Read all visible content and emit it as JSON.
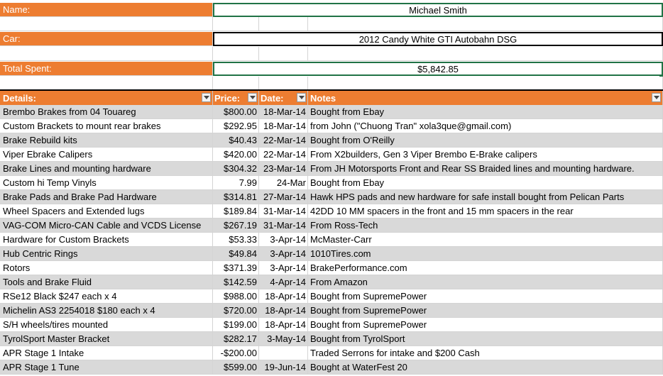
{
  "summary": {
    "name_label": "Name:",
    "name_value": "Michael Smith",
    "car_label": "Car:",
    "car_value": "2012 Candy White GTI Autobahn DSG",
    "total_label": "Total Spent:",
    "total_value": "$5,842.85"
  },
  "table": {
    "headers": [
      "Details:",
      "Price:",
      "Date:",
      "Notes"
    ],
    "rows": [
      [
        "Brembo Brakes from 04 Touareg",
        "$800.00",
        "18-Mar-14",
        "Bought from Ebay"
      ],
      [
        "Custom Brackets to mount rear brakes",
        "$292.95",
        "18-Mar-14",
        " from John (\"Chuong Tran\" xola3que@gmail.com)"
      ],
      [
        "Brake Rebuild kits",
        "$40.43",
        "22-Mar-14",
        "Bought from O'Reilly"
      ],
      [
        "Viper Ebrake Calipers",
        "$420.00",
        "22-Mar-14",
        "From X2builders, Gen 3 Viper Brembo E-Brake calipers"
      ],
      [
        "Brake Lines and mounting hardware",
        "$304.32",
        "23-Mar-14",
        "From JH Motorsports Front and Rear SS Braided lines and mounting hardware."
      ],
      [
        "Custom hi Temp Vinyls",
        "7.99",
        "24-Mar",
        "Bought from Ebay"
      ],
      [
        "Brake Pads and Brake Pad Hardware",
        "$314.81",
        "27-Mar-14",
        "Hawk HPS pads and new hardware for safe install bought from Pelican Parts"
      ],
      [
        "Wheel Spacers and Extended lugs",
        "$189.84",
        "31-Mar-14",
        "42DD 10 MM spacers in the front and 15 mm spacers in the rear"
      ],
      [
        "VAG-COM Micro-CAN Cable and VCDS License",
        "$267.19",
        "31-Mar-14",
        "From Ross-Tech"
      ],
      [
        "Hardware for Custom Brackets",
        "$53.33",
        "3-Apr-14",
        "McMaster-Carr"
      ],
      [
        "Hub Centric Rings",
        "$49.84",
        "3-Apr-14",
        "1010Tires.com"
      ],
      [
        "Rotors",
        "$371.39",
        "3-Apr-14",
        "BrakePerformance.com"
      ],
      [
        "Tools and Brake Fluid",
        "$142.59",
        "4-Apr-14",
        "From Amazon"
      ],
      [
        "RSe12 Black $247 each x 4",
        "$988.00",
        "18-Apr-14",
        "Bought from SupremePower"
      ],
      [
        "Michelin AS3 2254018 $180 each x 4",
        "$720.00",
        "18-Apr-14",
        "Bought from SupremePower"
      ],
      [
        "S/H wheels/tires mounted",
        "$199.00",
        "18-Apr-14",
        "Bought from SupremePower"
      ],
      [
        "TyrolSport Master Bracket",
        "$282.17",
        "3-May-14",
        "Bought from TyrolSport"
      ],
      [
        "APR Stage 1 Intake",
        "-$200.00",
        "",
        "Traded Serrons for intake and $200 Cash"
      ],
      [
        "APR Stage 1 Tune",
        "$599.00",
        "19-Jun-14",
        "Bought at WaterFest 20"
      ]
    ]
  },
  "colors": {
    "label_orange": "#ed7d31",
    "band_gray": "#d9d9d9",
    "selection_green": "#217346"
  }
}
